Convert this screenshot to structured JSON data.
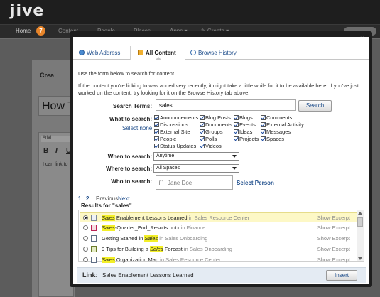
{
  "app": {
    "logo": "jive",
    "nav": {
      "home": "Home",
      "badge": "7",
      "content": "Content",
      "people": "People",
      "places": "Places",
      "apps": "Apps ▾",
      "create": "✎ Create ▾"
    }
  },
  "background": {
    "title": "Crea",
    "title_input": "How T",
    "font_select": "Arial",
    "bold": "B",
    "italic": "I",
    "underline": "U",
    "editor_text": "I can link to"
  },
  "modal": {
    "close": "×",
    "tabs": [
      {
        "label": "Web Address",
        "icon": "globe-icon"
      },
      {
        "label": "All Content",
        "icon": "all-content-icon"
      },
      {
        "label": "Browse History",
        "icon": "history-icon"
      }
    ],
    "instruction": "Use the form below to search for content.",
    "instruction2": "If the content you're linking to was added very recently, it might take a little while for it to be available here. If you've just worked on the content, try looking for it on the Browse History tab above.",
    "search_label": "Search Terms:",
    "search_value": "sales",
    "search_button": "Search",
    "what_label": "What to search:",
    "select_none": "Select none",
    "types_col1": [
      "Announcements",
      "Discussions",
      "External Site",
      "People",
      "Status Updates"
    ],
    "types_col2": [
      "Blog Posts",
      "Documents",
      "Groups",
      "Polls",
      "Videos"
    ],
    "types_col3": [
      "Blogs",
      "Events",
      "Ideas",
      "Projects"
    ],
    "types_col4": [
      "Comments",
      "External Activity",
      "Messages",
      "Spaces"
    ],
    "when_label": "When to search:",
    "when_value": "Anytime",
    "where_label": "Where to search:",
    "where_value": "All Spaces",
    "who_label": "Who to search:",
    "who_placeholder": "Jane Doe",
    "select_person": "Select Person",
    "pager": {
      "p1": "1",
      "p2": "2",
      "prev": "Previous",
      "next": "Next"
    },
    "results_label": "Results for \"sales\"",
    "results": [
      {
        "pre": "",
        "hl": "Sales",
        "post": " Enablement Lessons Learned",
        "in": " in Sales Resource Center",
        "excerpt": "Show Excerpt",
        "selected": true
      },
      {
        "pre": "",
        "hl": "Sales",
        "post": "-Quarter_End_Results.pptx",
        "in": " in Finance",
        "excerpt": "Show Excerpt",
        "selected": false
      },
      {
        "pre": "Getting Started in ",
        "hl": "Sales",
        "post": "",
        "in": " in Sales Onboarding",
        "excerpt": "Show Excerpt",
        "selected": false
      },
      {
        "pre": "9 Tips for Building a ",
        "hl": "Sales",
        "post": " Forcast",
        "in": " in Sales Onboarding",
        "excerpt": "Show Excerpt",
        "selected": false
      },
      {
        "pre": "",
        "hl": "Sales",
        "post": " Organization Map",
        "in": " in Sales Resource Center",
        "excerpt": "Show Excerpt",
        "selected": false
      }
    ],
    "link_label": "Link:",
    "link_value": "Sales Enablement Lessons Learned",
    "insert_button": "Insert"
  }
}
